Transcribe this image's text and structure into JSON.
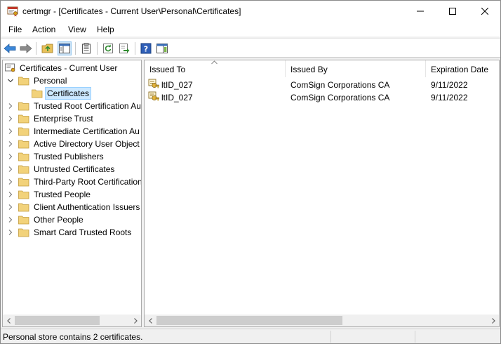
{
  "window": {
    "title": "certmgr - [Certificates - Current User\\Personal\\Certificates]",
    "icon": "certificate-manager-icon"
  },
  "menu": {
    "items": [
      "File",
      "Action",
      "View",
      "Help"
    ]
  },
  "toolbar": {
    "buttons": [
      "back-icon",
      "forward-icon",
      "up-folder-icon",
      "show-hide-console-tree-icon",
      "properties-icon",
      "refresh-icon",
      "export-list-icon",
      "help-icon",
      "show-action-pane-icon"
    ]
  },
  "tree": {
    "root": "Certificates - Current User",
    "nodes": [
      {
        "label": "Personal",
        "expanded": true,
        "level": 1
      },
      {
        "label": "Certificates",
        "selected": true,
        "level": 2
      },
      {
        "label": "Trusted Root Certification Au",
        "level": 1
      },
      {
        "label": "Enterprise Trust",
        "level": 1
      },
      {
        "label": "Intermediate Certification Au",
        "level": 1
      },
      {
        "label": "Active Directory User Object",
        "level": 1
      },
      {
        "label": "Trusted Publishers",
        "level": 1
      },
      {
        "label": "Untrusted Certificates",
        "level": 1
      },
      {
        "label": "Third-Party Root Certification",
        "level": 1
      },
      {
        "label": "Trusted People",
        "level": 1
      },
      {
        "label": "Client Authentication Issuers",
        "level": 1
      },
      {
        "label": "Other People",
        "level": 1
      },
      {
        "label": "Smart Card Trusted Roots",
        "level": 1
      }
    ]
  },
  "list": {
    "columns": [
      "Issued To",
      "Issued By",
      "Expiration Date"
    ],
    "rows": [
      {
        "issued_to": "ltID_027",
        "issued_by": "ComSign Corporations CA",
        "expiration": "9/11/2022"
      },
      {
        "issued_to": "ltID_027",
        "issued_by": "ComSign Corporations CA",
        "expiration": "9/11/2022"
      }
    ]
  },
  "status": {
    "text": "Personal store contains 2 certificates."
  },
  "colors": {
    "selection": "#cce8ff",
    "selection_border": "#99d1ff",
    "folder": "#e8c15a",
    "accent_blue": "#1e6ec8"
  }
}
